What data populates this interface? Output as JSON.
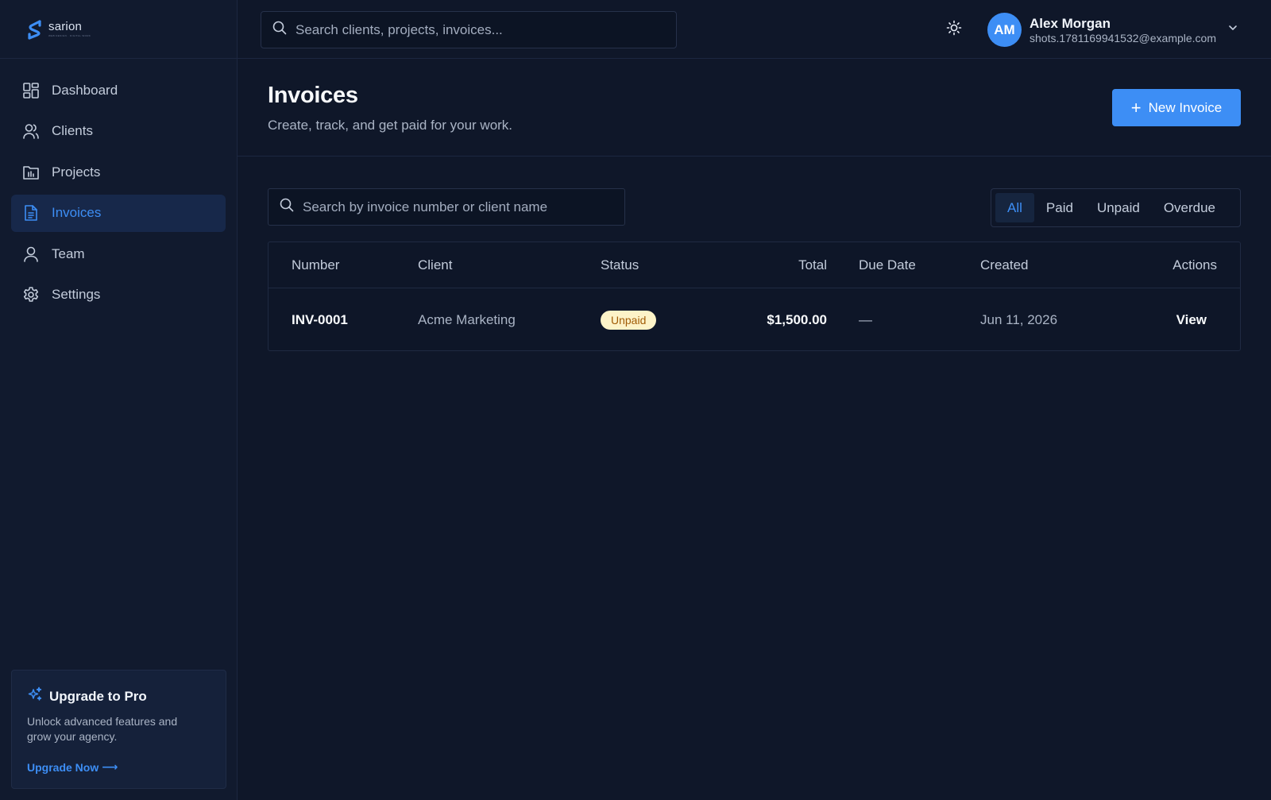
{
  "brand": {
    "name": "sarion",
    "tagline": "WEB DESIGN · DIGITAL WORK"
  },
  "sidebar": {
    "items": [
      {
        "label": "Dashboard",
        "icon": "dashboard-icon",
        "active": false
      },
      {
        "label": "Clients",
        "icon": "users-icon",
        "active": false
      },
      {
        "label": "Projects",
        "icon": "folder-chart-icon",
        "active": false
      },
      {
        "label": "Invoices",
        "icon": "document-icon",
        "active": true
      },
      {
        "label": "Team",
        "icon": "user-icon",
        "active": false
      },
      {
        "label": "Settings",
        "icon": "gear-icon",
        "active": false
      }
    ],
    "upgrade": {
      "title": "Upgrade to Pro",
      "description": "Unlock advanced features and grow your agency.",
      "cta": "Upgrade Now",
      "cta_arrow": "⟶"
    }
  },
  "topbar": {
    "search_placeholder": "Search clients, projects, invoices...",
    "theme_icon": "sun-icon",
    "user": {
      "initials": "AM",
      "name": "Alex Morgan",
      "email": "shots.1781169941532@example.com"
    }
  },
  "page": {
    "title": "Invoices",
    "subtitle": "Create, track, and get paid for your work.",
    "new_button": "New Invoice",
    "new_button_icon": "+"
  },
  "toolbar": {
    "search_placeholder": "Search by invoice number or client name",
    "filters": [
      "All",
      "Paid",
      "Unpaid",
      "Overdue"
    ],
    "active_filter": "All"
  },
  "table": {
    "columns": [
      "Number",
      "Client",
      "Status",
      "Total",
      "Due Date",
      "Created",
      "Actions"
    ],
    "rows": [
      {
        "number": "INV-0001",
        "client": "Acme Marketing",
        "status": "Unpaid",
        "total": "$1,500.00",
        "due_date": "—",
        "created": "Jun 11, 2026",
        "action": "View"
      }
    ]
  },
  "colors": {
    "accent": "#3d8ef5",
    "background": "#0f1729",
    "sidebar": "#111a2e",
    "badge_unpaid_bg": "#fdf3c8",
    "badge_unpaid_text": "#a15c07"
  }
}
